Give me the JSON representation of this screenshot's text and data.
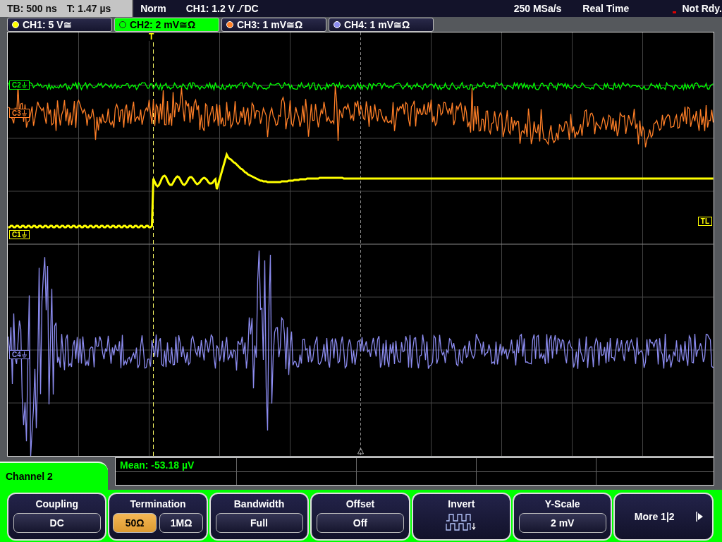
{
  "status_bar": {
    "timebase": "TB: 500 ns",
    "trigger_time": "T: 1.47 µs",
    "mode": "Norm",
    "trigger_source": "CH1: 1.2 V",
    "trigger_coupling": "DC",
    "sample_rate": "250 MSa/s",
    "acquisition": "Real Time",
    "state": "Not Rdy."
  },
  "channels": [
    {
      "label": "CH1: 5 V≅",
      "color": "#ffff00",
      "selected": false
    },
    {
      "label": "CH2: 2 mV≅Ω",
      "color": "#00ff00",
      "selected": true
    },
    {
      "label": "CH3: 1 mV≅Ω",
      "color": "#ff7f27",
      "selected": false
    },
    {
      "label": "CH4: 1 mV≅Ω",
      "color": "#8c8cf0",
      "selected": false
    }
  ],
  "waveform_area": {
    "trigger_marker": "T",
    "trigger_level_label": "TL",
    "trace_labels": [
      {
        "text": "C2",
        "color": "#00ff00"
      },
      {
        "text": "C3",
        "color": "#ff7f27"
      },
      {
        "text": "C1",
        "color": "#ffff00"
      },
      {
        "text": "C4",
        "color": "#8c8cf0"
      }
    ]
  },
  "measurement": {
    "text": "Mean: -53.18 µV"
  },
  "menu": {
    "title": "Channel 2",
    "items": [
      {
        "kind": "value",
        "label": "Coupling",
        "value": "DC"
      },
      {
        "kind": "toggle",
        "label": "Termination",
        "options": [
          {
            "text": "50Ω",
            "selected": true
          },
          {
            "text": "1MΩ",
            "selected": false
          }
        ]
      },
      {
        "kind": "value",
        "label": "Bandwidth",
        "value": "Full"
      },
      {
        "kind": "value",
        "label": "Offset",
        "value": "Off"
      },
      {
        "kind": "icon",
        "label": "Invert"
      },
      {
        "kind": "value",
        "label": "Y-Scale",
        "value": "2 mV"
      },
      {
        "kind": "more",
        "label": "More 1|2"
      }
    ]
  }
}
